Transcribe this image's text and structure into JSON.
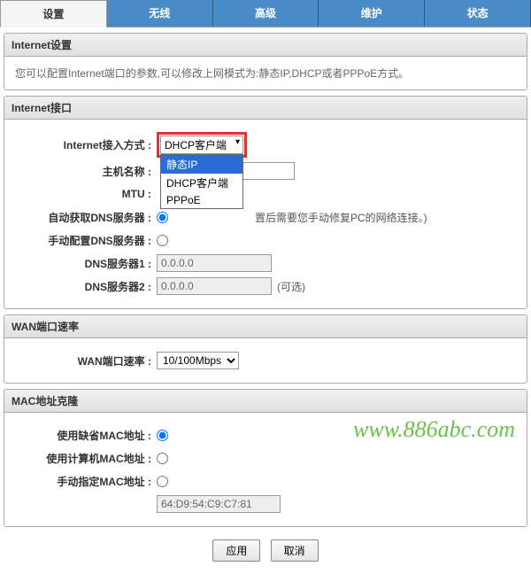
{
  "tabs": {
    "settings": "设置",
    "wireless": "无线",
    "advanced": "高级",
    "maintenance": "维护",
    "status": "状态"
  },
  "internet_settings": {
    "title": "Internet设置",
    "desc": "您可以配置Internet端口的参数,可以修改上网模式为:静态IP,DHCP或者PPPoE方式。"
  },
  "internet_iface": {
    "title": "Internet接口",
    "access_label": "Internet接入方式 :",
    "access_selected": "DHCP客户端",
    "access_options": {
      "static": "静态IP",
      "dhcp": "DHCP客户端",
      "pppoe": "PPPoE"
    },
    "host_label": "主机名称 :",
    "host_value": "",
    "mtu_label": "MTU :",
    "auto_dns_label": "自动获取DNS服务器 :",
    "auto_dns_hint": "置后需要您手动修复PC的网络连接。)",
    "manual_dns_label": "手动配置DNS服务器 :",
    "dns1_label": "DNS服务器1 :",
    "dns1_value": "0.0.0.0",
    "dns2_label": "DNS服务器2 :",
    "dns2_value": "0.0.0.0",
    "dns2_hint": "(可选)"
  },
  "wan_speed": {
    "title": "WAN端口速率",
    "label": "WAN端口速率 :",
    "value": "10/100Mbps"
  },
  "mac_clone": {
    "title": "MAC地址克隆",
    "default_label": "使用缺省MAC地址 :",
    "pc_label": "使用计算机MAC地址 :",
    "manual_label": "手动指定MAC地址 :",
    "manual_value": "64:D9:54:C9:C7:81"
  },
  "buttons": {
    "apply": "应用",
    "cancel": "取消"
  },
  "watermark": "www.886abc.com"
}
